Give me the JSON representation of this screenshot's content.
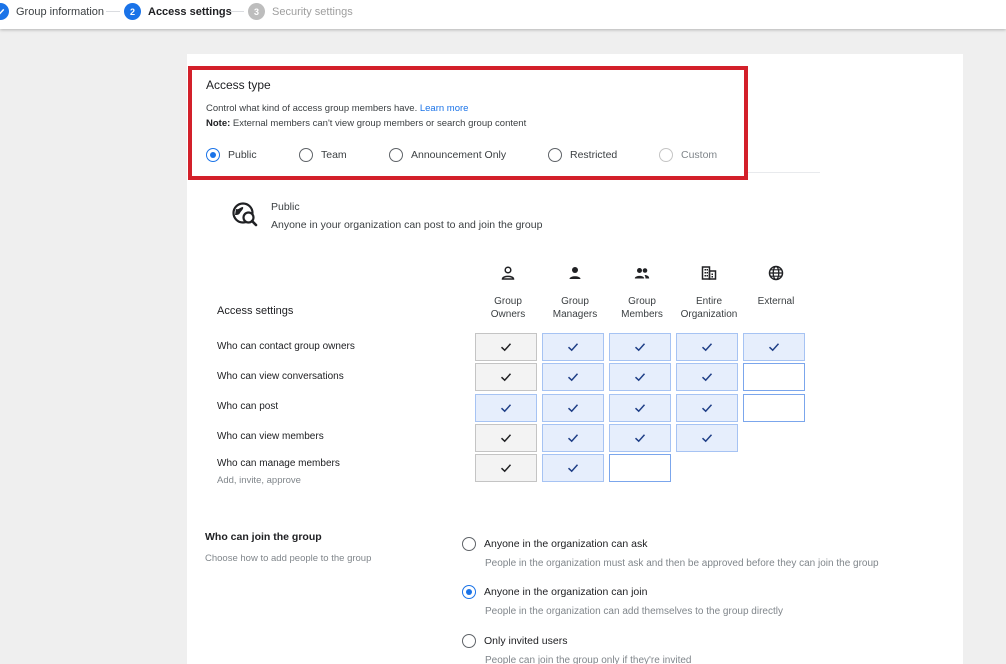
{
  "stepper": {
    "steps": [
      {
        "number": "",
        "label": "Group information",
        "state": "done"
      },
      {
        "number": "2",
        "label": "Access settings",
        "state": "active"
      },
      {
        "number": "3",
        "label": "Security settings",
        "state": "pending"
      }
    ]
  },
  "access_type": {
    "title": "Access type",
    "description": "Control what kind of access group members have.",
    "learn_more": "Learn more",
    "note_label": "Note:",
    "note_text": "External members can't view group members or search group content",
    "options": [
      {
        "label": "Public",
        "selected": true
      },
      {
        "label": "Team",
        "selected": false
      },
      {
        "label": "Announcement Only",
        "selected": false
      },
      {
        "label": "Restricted",
        "selected": false
      },
      {
        "label": "Custom",
        "selected": false,
        "disabled": true
      }
    ]
  },
  "summary": {
    "icon": "public-search-icon",
    "title": "Public",
    "description": "Anyone in your organization can post to and join the group"
  },
  "access_settings": {
    "heading": "Access settings",
    "roles": [
      {
        "label_line1": "Group",
        "label_line2": "Owners",
        "icon": "person-outline-icon"
      },
      {
        "label_line1": "Group",
        "label_line2": "Managers",
        "icon": "person-icon"
      },
      {
        "label_line1": "Group",
        "label_line2": "Members",
        "icon": "people-icon"
      },
      {
        "label_line1": "Entire",
        "label_line2": "Organization",
        "icon": "building-icon"
      },
      {
        "label_line1": "External",
        "label_line2": "",
        "icon": "globe-icon"
      }
    ],
    "rows": [
      {
        "label": "Who can contact group owners",
        "sub": "",
        "cells": [
          "gray-check",
          "blue-check",
          "blue-check",
          "blue-check",
          "blue-check"
        ]
      },
      {
        "label": "Who can view conversations",
        "sub": "",
        "cells": [
          "gray-check",
          "blue-check",
          "blue-check",
          "blue-check",
          "empty"
        ]
      },
      {
        "label": "Who can post",
        "sub": "",
        "cells": [
          "blue-check",
          "blue-check",
          "blue-check",
          "blue-check",
          "empty"
        ]
      },
      {
        "label": "Who can view members",
        "sub": "",
        "cells": [
          "gray-check",
          "blue-check",
          "blue-check",
          "blue-check",
          "none"
        ]
      },
      {
        "label": "Who can manage members",
        "sub": "Add, invite, approve",
        "cells": [
          "gray-check",
          "blue-check",
          "empty",
          "none",
          "none"
        ]
      }
    ]
  },
  "join": {
    "title": "Who can join the group",
    "description": "Choose how to add people to the group",
    "options": [
      {
        "label": "Anyone in the organization can ask",
        "sub": "People in the organization must ask and then be approved before they can join the group",
        "selected": false
      },
      {
        "label": "Anyone in the organization can join",
        "sub": "People in the organization can add themselves to the group directly",
        "selected": true
      },
      {
        "label": "Only invited users",
        "sub": "People can join the group only if they're invited",
        "selected": false
      }
    ]
  },
  "colors": {
    "accent": "#1a73e8",
    "highlight_border": "#d3202a",
    "cell_gray": "#f3f3f3",
    "cell_blue": "#e6eefc"
  }
}
